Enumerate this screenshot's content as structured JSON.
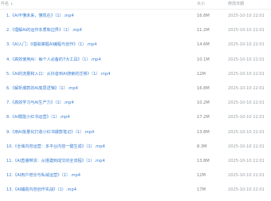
{
  "header": {
    "name_label": "件名 ↓",
    "size_label": "大小",
    "date_label": "修改日期"
  },
  "files": [
    {
      "name": "1.《AI不懂未来，懂现在》（1）.mp4",
      "size": "16.8M",
      "date": "2025-10-10 22:01"
    },
    {
      "name": "2.《理解AI的运作本质和边界》（1）.mp4",
      "size": "11.2M",
      "date": "2025-10-10 22:01"
    },
    {
      "name": "3.《AI入门：0基础掌握AI编程与创作》（1）.mp4",
      "size": "14.6M",
      "date": "2025-10-10 22:01"
    },
    {
      "name": "4.《高效使用AI：每个人必备的7大工具》（1）.mp4",
      "size": "10.1M",
      "date": "2025-10-10 22:01"
    },
    {
      "name": "5.《AI的流量和入口：从抖音到AI搜索的迁移》（1）.mp4",
      "size": "12M",
      "date": "2025-10-10 22:01"
    },
    {
      "name": "6.《解析爆款的AI底层逻辑》（1）.mp4",
      "size": "16.8M",
      "date": "2025-10-10 22:01"
    },
    {
      "name": "7.《高效学习与AI生产力》（1）.mp4",
      "size": "10.2M",
      "date": "2025-10-10 22:01"
    },
    {
      "name": "8.《AI赋能小红书运营》（1）.mp4",
      "size": "17.2M",
      "date": "2025-10-10 22:01"
    },
    {
      "name": "9.《用AI批量化打造小红书爆款笔记》（1）.mp4",
      "size": "13.8M",
      "date": "2025-10-10 22:01"
    },
    {
      "name": "10.《全域内容运营：多平台内容一键生成》（1）.mp4",
      "size": "8.3M",
      "date": "2025-10-10 22:01"
    },
    {
      "name": "11.《AI直播带货：从搭建到成交的全流程》（1）.mp4",
      "size": "13.8M",
      "date": "2025-10-10 22:01"
    },
    {
      "name": "12.《AI用户增长与私域运营》（1）.mp4",
      "size": "12M",
      "date": "2025-10-10 22:01"
    },
    {
      "name": "13.《AI辅助内容创作实战》（1）.mp4",
      "size": "17M",
      "date": "2025-10-10 22:01"
    }
  ]
}
